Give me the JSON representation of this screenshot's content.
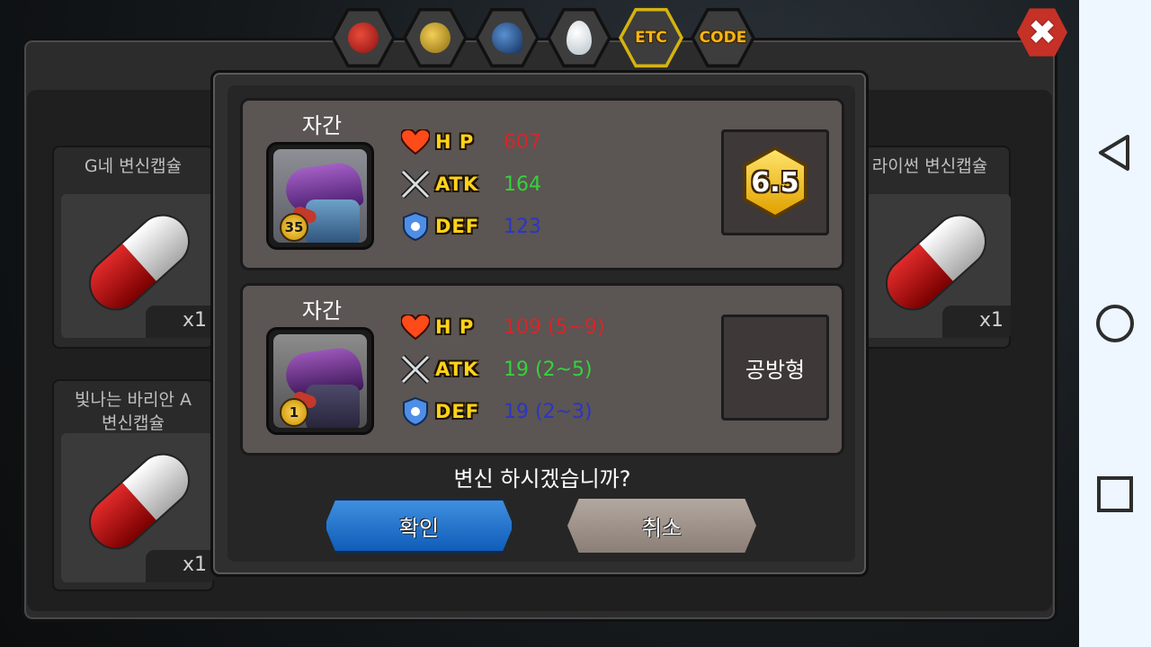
{
  "tabs": [
    {
      "icon": "fruit-icon",
      "label": ""
    },
    {
      "icon": "nugget-icon",
      "label": ""
    },
    {
      "icon": "dragon-head-icon",
      "label": ""
    },
    {
      "icon": "egg-icon",
      "label": ""
    },
    {
      "icon": "",
      "label": "ETC",
      "active": true
    },
    {
      "icon": "",
      "label": "CODE"
    }
  ],
  "background_items": [
    {
      "name": "G네 변신캡슐",
      "qty": "x1"
    },
    {
      "name": "라이썬 변신캡슐",
      "qty": "x1"
    },
    {
      "name": "빛나는 바리안 A\n변신캡슐",
      "qty": "x1"
    }
  ],
  "current": {
    "name": "자간",
    "level": "35",
    "hp_label": "H P",
    "atk_label": "ATK",
    "def_label": "DEF",
    "hp": "607",
    "atk": "164",
    "def": "123",
    "grade": "6.5"
  },
  "result": {
    "name": "자간",
    "level": "1",
    "hp_label": "H P",
    "atk_label": "ATK",
    "def_label": "DEF",
    "hp": "109 (5~9)",
    "atk": "19 (2~5)",
    "def": "19 (2~3)",
    "type": "공방형"
  },
  "dialog": {
    "question": "변신 하시겠습니까?",
    "confirm_label": "확인",
    "cancel_label": "취소"
  },
  "colors": {
    "hp": "#d6262a",
    "atk": "#36d23c",
    "def": "#2b35c6",
    "confirm": "#1a6fd0",
    "close": "#c63127"
  }
}
